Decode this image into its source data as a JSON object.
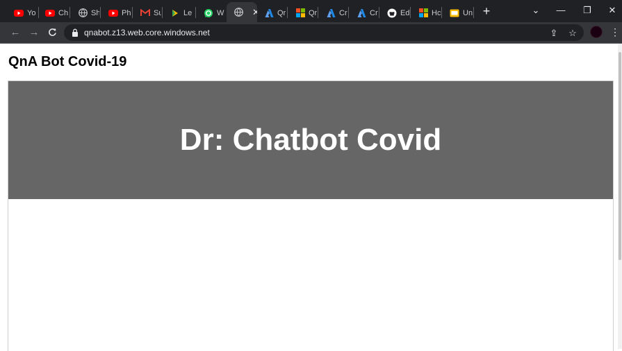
{
  "browser": {
    "tabs": [
      {
        "title": "Yo",
        "icon": "youtube-icon",
        "color": "#ff0000"
      },
      {
        "title": "Ch",
        "icon": "youtube-icon",
        "color": "#ff0000"
      },
      {
        "title": "Sh",
        "icon": "globe-icon",
        "color": "#c9cbcf"
      },
      {
        "title": "Ph",
        "icon": "youtube-icon",
        "color": "#ff0000"
      },
      {
        "title": "Sul",
        "icon": "gmail-icon",
        "color": "#ea4335"
      },
      {
        "title": "Le",
        "icon": "google-play-icon",
        "color": "#fbbc04"
      },
      {
        "title": "Wl",
        "icon": "whatsapp-icon",
        "color": "#25d366"
      },
      {
        "title": "",
        "icon": "globe-icon",
        "color": "#c9cbcf",
        "active": true
      },
      {
        "title": "Qr",
        "icon": "azure-icon",
        "color": "#1e88e5"
      },
      {
        "title": "Qr",
        "icon": "microsoft-icon",
        "color": "#f25022"
      },
      {
        "title": "Cr",
        "icon": "azure-icon",
        "color": "#1e88e5"
      },
      {
        "title": "Cr",
        "icon": "azure-icon",
        "color": "#1e88e5"
      },
      {
        "title": "Ed",
        "icon": "github-icon",
        "color": "#ffffff"
      },
      {
        "title": "Hc",
        "icon": "microsoft-icon",
        "color": "#f25022"
      },
      {
        "title": "Un",
        "icon": "note-icon",
        "color": "#fbbc04"
      }
    ],
    "new_tab_label": "+",
    "tab_search_label": "⌄",
    "minimize_label": "—",
    "restore_label": "❐",
    "close_label": "✕",
    "active_tab_close": "✕",
    "back_label": "←",
    "forward_label": "→",
    "reload_label": "C",
    "url": "qnabot.z13.web.core.windows.net",
    "share_label": "⇪",
    "bookmark_label": "☆",
    "menu_label": "⋮"
  },
  "page": {
    "title": "QnA Bot Covid-19",
    "banner_title": "Dr: Chatbot Covid",
    "banner_color": "#666666"
  }
}
